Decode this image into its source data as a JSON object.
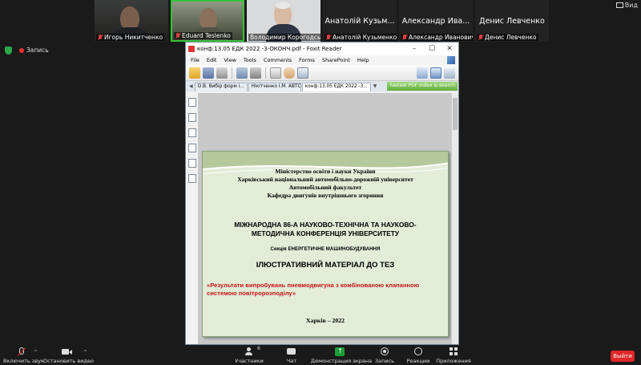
{
  "colors": {
    "accent_green": "#36c23a",
    "share_green": "#1e9e3a",
    "leave_red": "#e02828",
    "slide_red_text": "#c8141d"
  },
  "participants": [
    {
      "name": "Игорь Никитченко",
      "muted": true,
      "video": true
    },
    {
      "name": "Eduard Teslenko",
      "muted": true,
      "video": true,
      "active_speaker": true
    },
    {
      "name": "Володимир Корогодський",
      "muted": false,
      "video": true
    },
    {
      "name": "Анатолій Кузьменко",
      "muted": true,
      "video": false,
      "tile_name": "Анатолій Кузьм..."
    },
    {
      "name": "Александр Иванович",
      "muted": true,
      "video": false,
      "tile_name": "Александр Ива..."
    },
    {
      "name": "Денис Левченко",
      "muted": true,
      "video": false,
      "tile_name": "Денис Левченко"
    }
  ],
  "top": {
    "recording_label": "Запись",
    "view_label": "Вид"
  },
  "window": {
    "title": "конф.13.05 ЕДК 2022 -3-ОКОНЧ.pdf - Foxit Reader",
    "controls": [
      "–",
      "☐",
      "✕"
    ],
    "menu": [
      "File",
      "Edit",
      "View",
      "Tools",
      "Comments",
      "Forms",
      "SharePoint",
      "Help"
    ],
    "tabs": [
      {
        "label": "О.В. Вибір форм і...",
        "active": false
      },
      {
        "label": "Нікітченко І.М. АВТОМОБ...",
        "active": false
      },
      {
        "label": "конф.13.05 ЕДК 2022 -3...",
        "active": true
      }
    ],
    "search_ad": "Fastest PDF index & search"
  },
  "slide": {
    "ministry_lines": [
      "Міністерство освіти і науки України",
      "Харківський національний автомобільно-дорожній університет",
      "Автомобільний факультет",
      "Кафедра двигунів внутрішнього згоряння"
    ],
    "conference_lines": [
      "МІЖНАРОДНА 86-А НАУКОВО-ТЕХНІЧНА ТА НАУКОВО-",
      "МЕТОДИЧНА  КОНФЕРЕНЦІЯ УНІВЕРСИТЕТУ"
    ],
    "section": "Секція ЕНЕРГЕТИЧНЕ МАШИНОБУДУВАННЯ",
    "illustrative": "ІЛЮСТРАТИВНИЙ МАТЕРІАЛ ДО  ТЕЗ",
    "topic_lines": [
      "«Результати випробувань пневмодвигуна з комбінованою клапанною",
      "системою повітророзподілу»"
    ],
    "city": "Харків – 2022"
  },
  "bottom": {
    "mute_label": "Включить звук",
    "video_label": "Остановить видео",
    "participants_label": "Участники",
    "participants_count": "6",
    "chat_label": "Чат",
    "share_label": "Демонстрация экрана",
    "record_label": "Запись",
    "reactions_label": "Реакции",
    "apps_label": "Приложения",
    "leave_label": "Выйти"
  }
}
